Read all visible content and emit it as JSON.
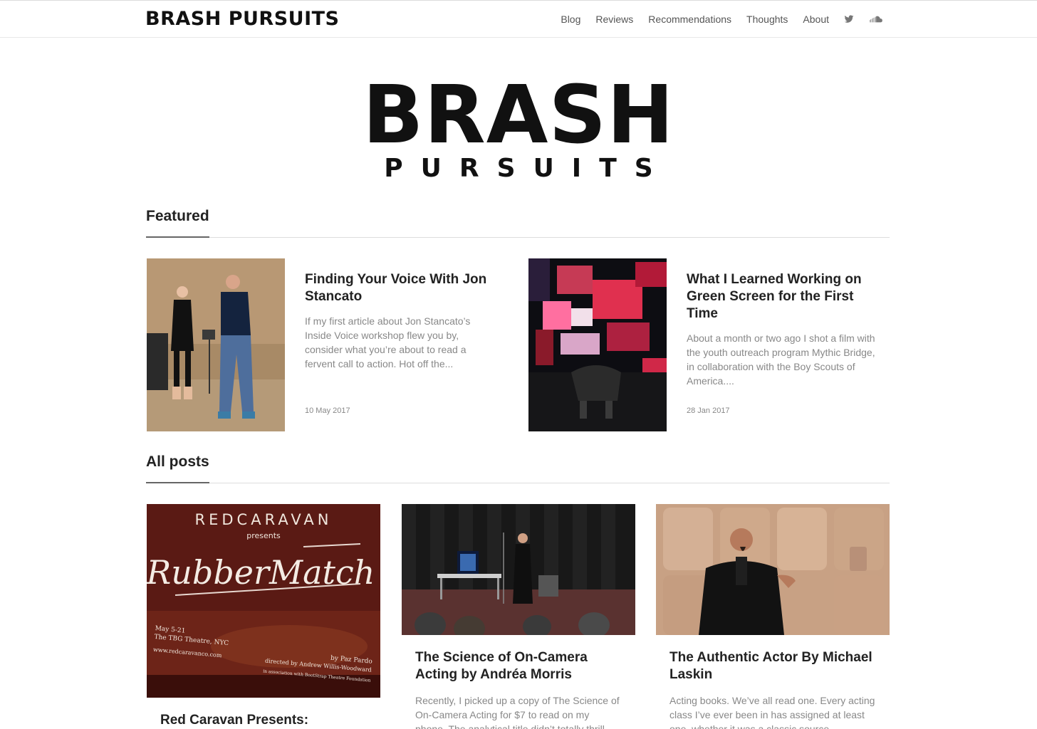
{
  "site": {
    "brand": "BRASH PURSUITS",
    "hero_top": "BRASH",
    "hero_bottom": "PURSUITS"
  },
  "nav": {
    "items": [
      {
        "label": "Blog"
      },
      {
        "label": "Reviews"
      },
      {
        "label": "Recommendations"
      },
      {
        "label": "Thoughts"
      },
      {
        "label": "About"
      }
    ],
    "icons": [
      "twitter-icon",
      "soundcloud-icon"
    ]
  },
  "featured": {
    "heading": "Featured",
    "posts": [
      {
        "title": "Finding Your Voice With Jon Stancato",
        "excerpt": "If my first article about Jon Stancato’s Inside Voice workshop flew you by, consider what you’re about to read a fervent call to action. Hot off the...",
        "date": "10 May 2017"
      },
      {
        "title": "What I Learned Working on Green Screen for the First Time",
        "excerpt": "About a month or two ago I shot a film with the youth outreach program Mythic Bridge, in collaboration with the Boy Scouts of America....",
        "date": "28 Jan 2017"
      }
    ]
  },
  "all_posts": {
    "heading": "All posts",
    "poster": {
      "company": "REDCARAVAN",
      "presents": "presents",
      "show": "RubberMatch",
      "dates": "May 5-21",
      "venue": "The TBG Theatre, NYC",
      "site": "www.redcaravanco.com",
      "author": "by Paz Pardo",
      "director": "directed by Andrew Willis-Woodward",
      "assoc": "in association with BootStrap Theatre Foundation"
    },
    "posts": [
      {
        "title": "Red Caravan Presents:",
        "excerpt": ""
      },
      {
        "title": "The Science of On-Camera Acting by Andréa Morris",
        "excerpt": "Recently, I picked up a copy of The Science of On-Camera Acting for $7 to read on my phone. The analytical title didn’t totally thrill"
      },
      {
        "title": "The Authentic Actor By Michael Laskin",
        "excerpt": "Acting books. We’ve all read one. Every acting class I’ve ever been in has assigned at least one, whether it was a classic source"
      }
    ]
  }
}
